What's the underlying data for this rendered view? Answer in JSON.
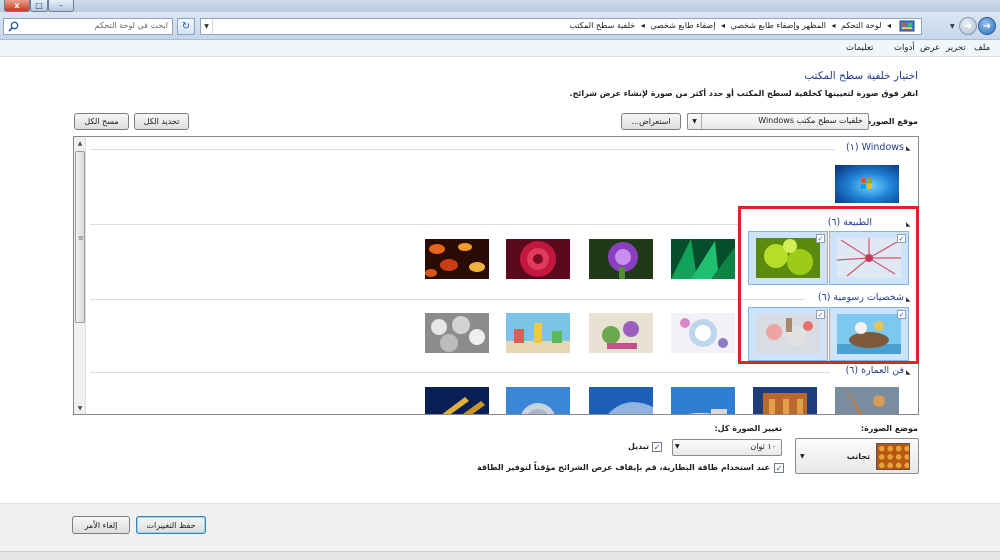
{
  "titlebar": {
    "close": "x",
    "maximize": "□",
    "minimize": "–"
  },
  "address": {
    "search_placeholder": "ابحث في لوحة التحكم",
    "breadcrumb": [
      "لوحة التحكم",
      "المظهر وإضفاء طابع شخصي",
      "إضفاء طابع شخصي",
      "خلفية سطح المكتب"
    ],
    "separator": "◂"
  },
  "menu": [
    "ملف",
    "تحرير",
    "عرض",
    "أدوات",
    "تعليمات"
  ],
  "page": {
    "title": "اختيار خلفية سطح المكتب",
    "description": "انقر فوق صورة لتعيينها كخلفية لسطح المكتب أو حدد أكثر من صورة لإنشاء عرض شرائح."
  },
  "location": {
    "label": "موقع الصورة:",
    "value": "خلفيات سطح مكتب Windows",
    "browse": "استعراض...",
    "select_all": "تحديد الكل",
    "clear_all": "مسح الكل"
  },
  "groups": [
    {
      "label": "Windows (١)"
    },
    {
      "label": "الطبيعة (٦)"
    },
    {
      "label": "شخصيات رسومية (٦)"
    },
    {
      "label": "فن العمارة (٦)"
    }
  ],
  "options": {
    "position_label": "موضع الصورة:",
    "position_value": "تجانب",
    "interval_label": "تغيير الصورة كل:",
    "interval_value": "١٠ ثوان",
    "shuffle_label": "تبديل",
    "battery_label": "عند استخدام طاقة البطارية، قم بإيقاف عرض الشرائح مؤقتاً لتوفير الطاقة",
    "checkmark": "✓"
  },
  "footer": {
    "save": "حفظ التغييرات",
    "cancel": "إلغاء الأمر"
  },
  "colors": {
    "accent": "#1f3e8c",
    "highlight": "#e3212d",
    "selection": "#cde3fa"
  },
  "icons": [
    "search-icon",
    "refresh-icon",
    "control-panel-icon",
    "back-icon",
    "forward-icon"
  ]
}
